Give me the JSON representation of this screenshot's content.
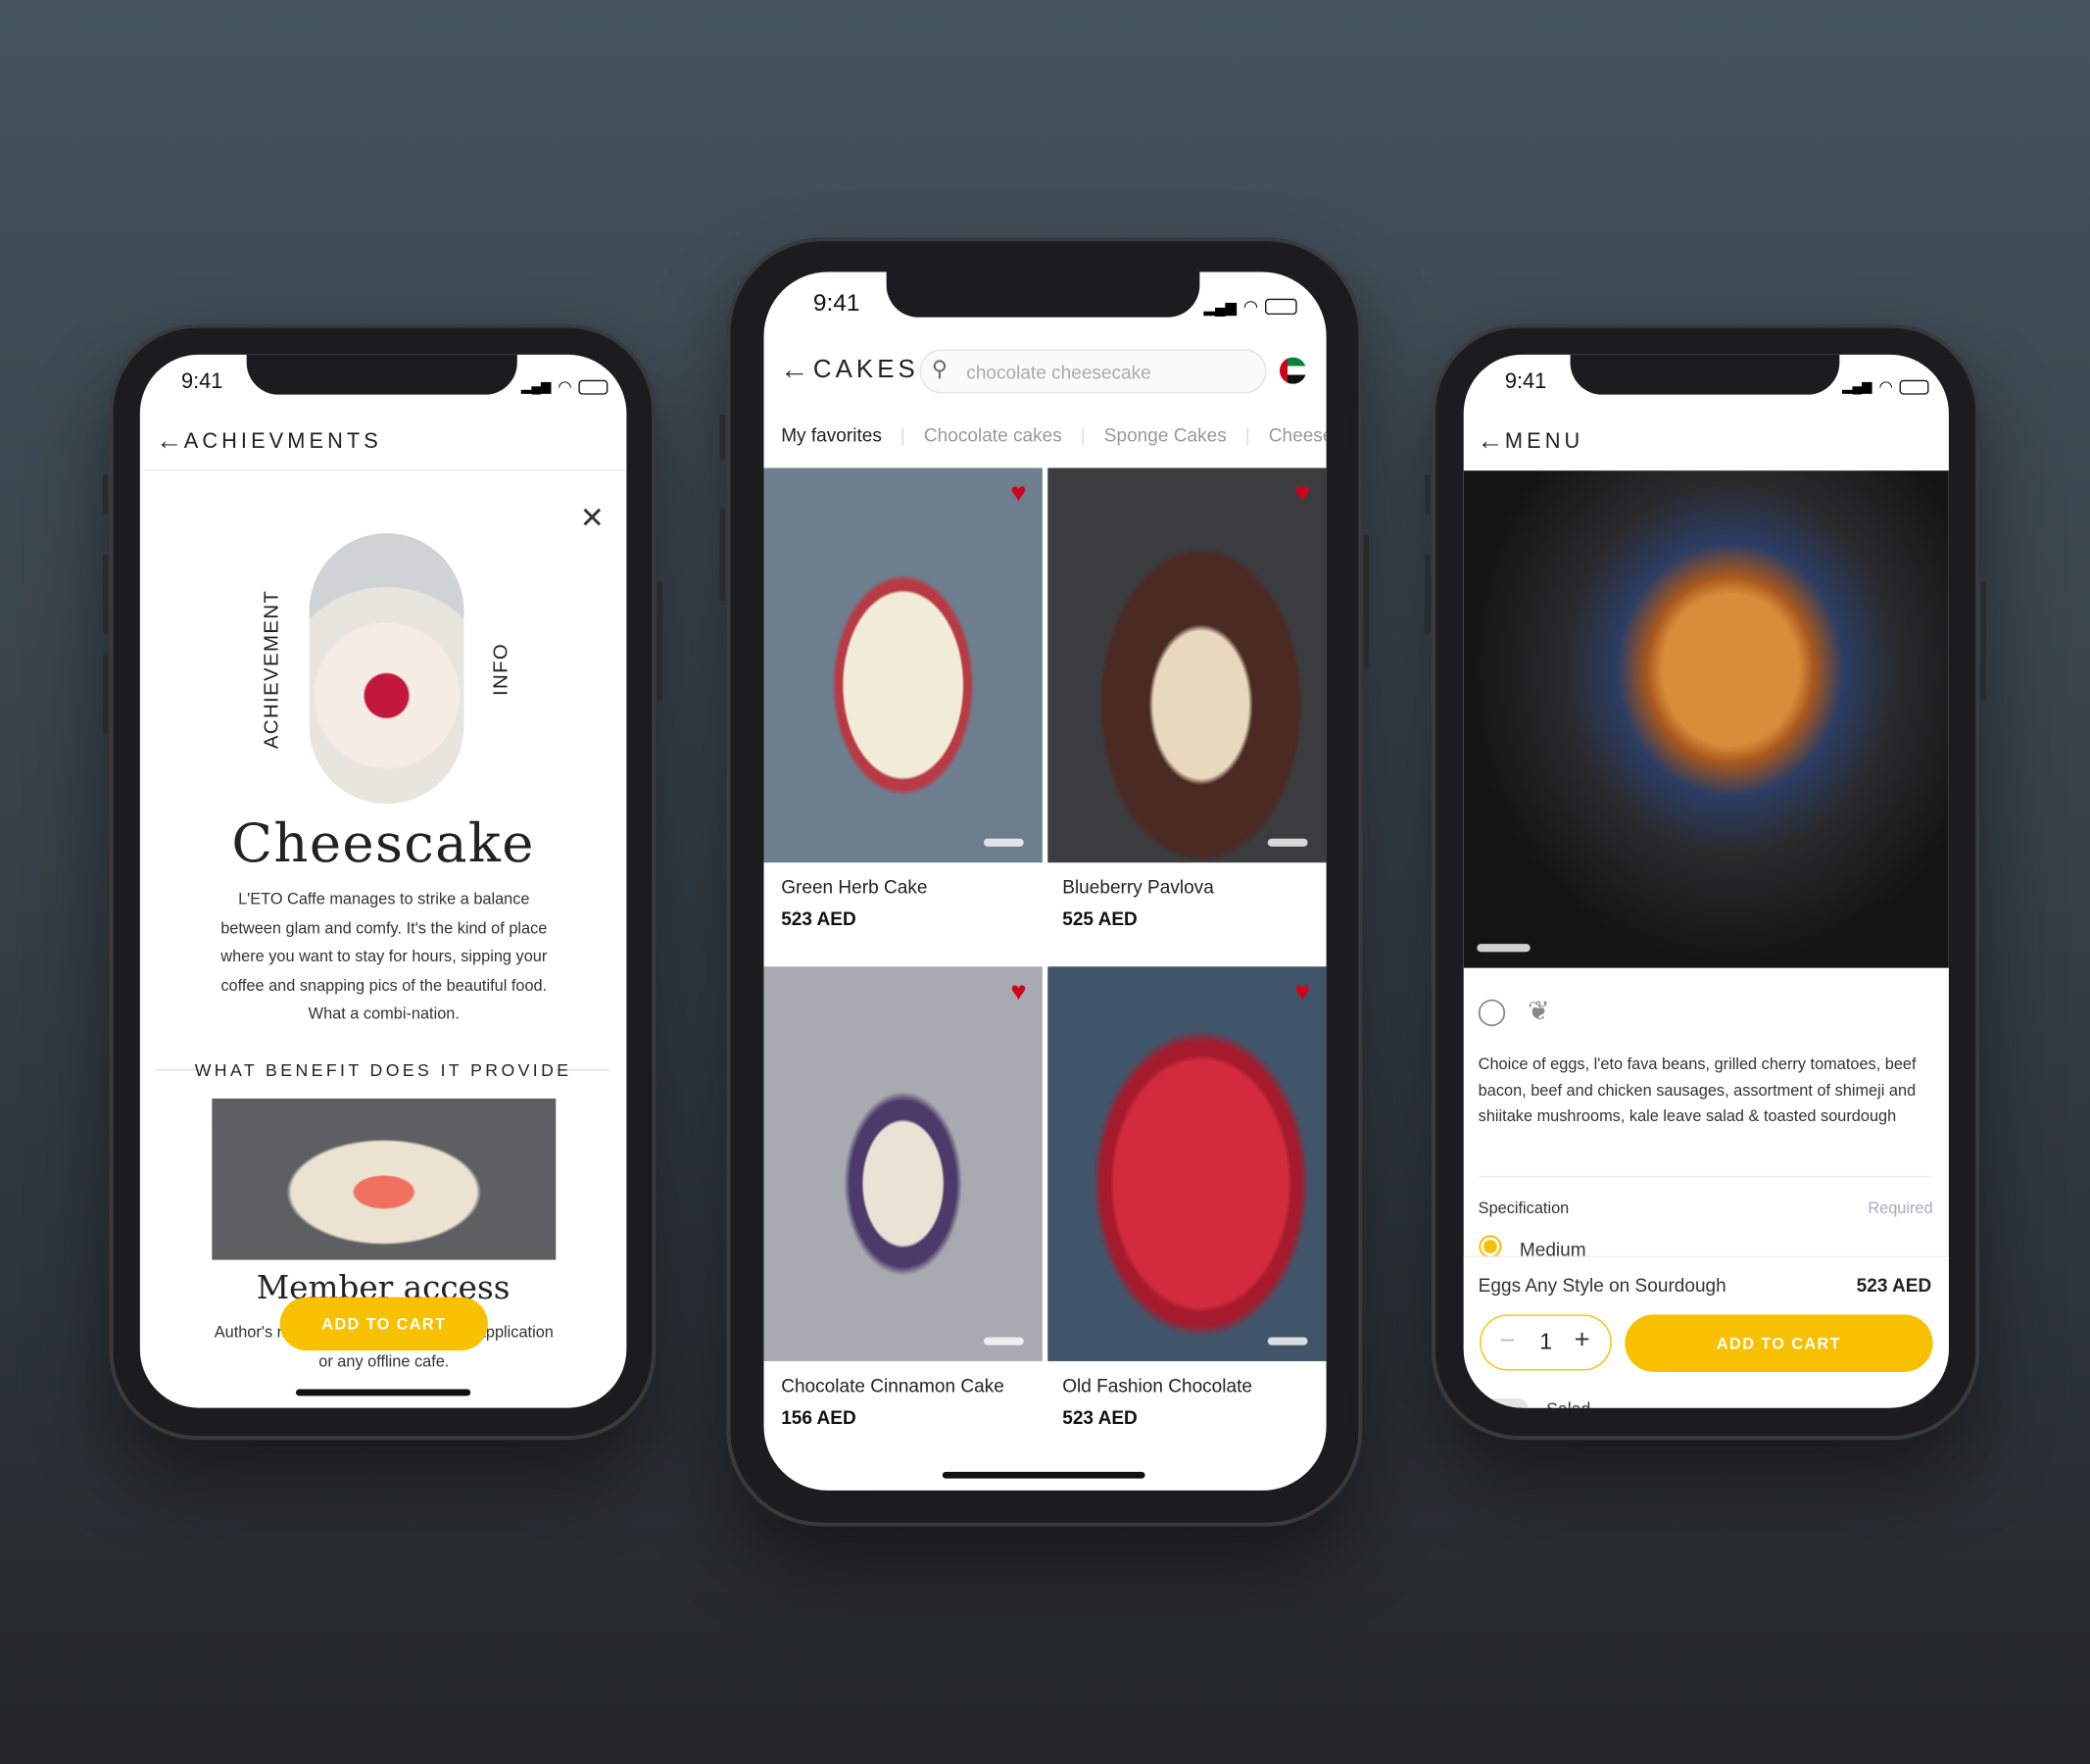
{
  "status_time": "9:41",
  "left": {
    "header": "ACHIEVMENTS",
    "side_left": "ACHIEVEMENT",
    "side_right": "INFO",
    "title": "Cheescake",
    "description": "L'ETO Caffe manages to strike a balance between glam and comfy. It's the kind of place where you want to stay for hours, sipping your coffee and snapping pics of the beautiful food. What a combi-nation.",
    "section": "WHAT BENEFIT DOES IT PROVIDE",
    "member_title": "Member access",
    "member_text": "Author's r... to you for ordering in the application or any offline cafe.",
    "cart": "ADD TO CART"
  },
  "center": {
    "header": "CAKES",
    "search_value": "chocolate cheesecake",
    "tabs": [
      "My favorites",
      "Chocolate cakes",
      "Sponge Cakes",
      "Cheesec"
    ],
    "items": [
      {
        "name": "Green Herb Cake",
        "price": "523 AED"
      },
      {
        "name": "Blueberry Pavlova",
        "price": "525 AED"
      },
      {
        "name": "Chocolate Cinnamon Cake",
        "price": "156 AED"
      },
      {
        "name": "Old Fashion Chocolate",
        "price": "523 AED"
      }
    ]
  },
  "right": {
    "header": "MENU",
    "description": "Choice of eggs, l'eto fava beans, grilled cherry tomatoes, beef bacon, beef and chicken sausages, assortment of shimeji and shiitake mushrooms, kale leave salad & toasted sourdough",
    "spec_label": "Specification",
    "spec_required": "Required",
    "option": "Medium",
    "next_option": "Salad",
    "product": "Eggs Any Style on Sourdough",
    "price": "523 AED",
    "quantity": "1",
    "cart": "ADD TO CART"
  },
  "colors": {
    "accent": "#f7c000",
    "heart": "#d0021b"
  }
}
